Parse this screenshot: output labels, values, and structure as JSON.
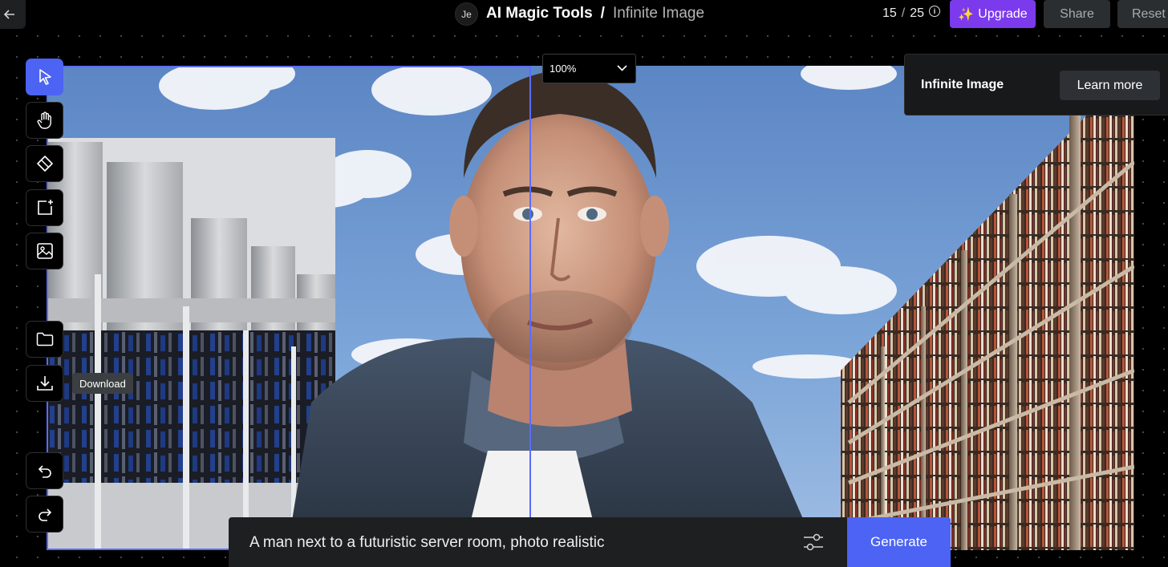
{
  "topbar": {
    "back_icon": "arrow-left-icon",
    "avatar_initials": "Je",
    "app_name": "AI Magic Tools",
    "separator": "/",
    "page_name": "Infinite Image",
    "credits_used": "15",
    "credits_sep": "/",
    "credits_total": "25",
    "upgrade_label": "Upgrade",
    "upgrade_icon": "✨",
    "share_label": "Share",
    "reset_label": "Reset"
  },
  "colors": {
    "accent": "#4c63f3",
    "upgrade": "#7c3aed",
    "selection": "#5b6cff"
  },
  "toolbar": {
    "tools": [
      {
        "name": "select",
        "icon": "cursor-icon",
        "active": true
      },
      {
        "name": "hand",
        "icon": "hand-icon",
        "active": false
      },
      {
        "name": "eraser",
        "icon": "eraser-icon",
        "active": false
      },
      {
        "name": "add-frame",
        "icon": "add-frame-icon",
        "active": false
      },
      {
        "name": "image",
        "icon": "image-icon",
        "active": false
      },
      {
        "name": "folder",
        "icon": "folder-icon",
        "active": false
      },
      {
        "name": "download",
        "icon": "download-icon",
        "active": false
      },
      {
        "name": "undo",
        "icon": "undo-icon",
        "active": false
      },
      {
        "name": "redo",
        "icon": "redo-icon",
        "active": false
      }
    ],
    "tooltip": "Download"
  },
  "zoom": {
    "value": "100%"
  },
  "info_panel": {
    "title": "Infinite Image",
    "learn_more_label": "Learn more"
  },
  "prompt": {
    "text": "A man next to a futuristic server room, photo realistic",
    "settings_icon": "sliders-icon",
    "generate_label": "Generate"
  }
}
